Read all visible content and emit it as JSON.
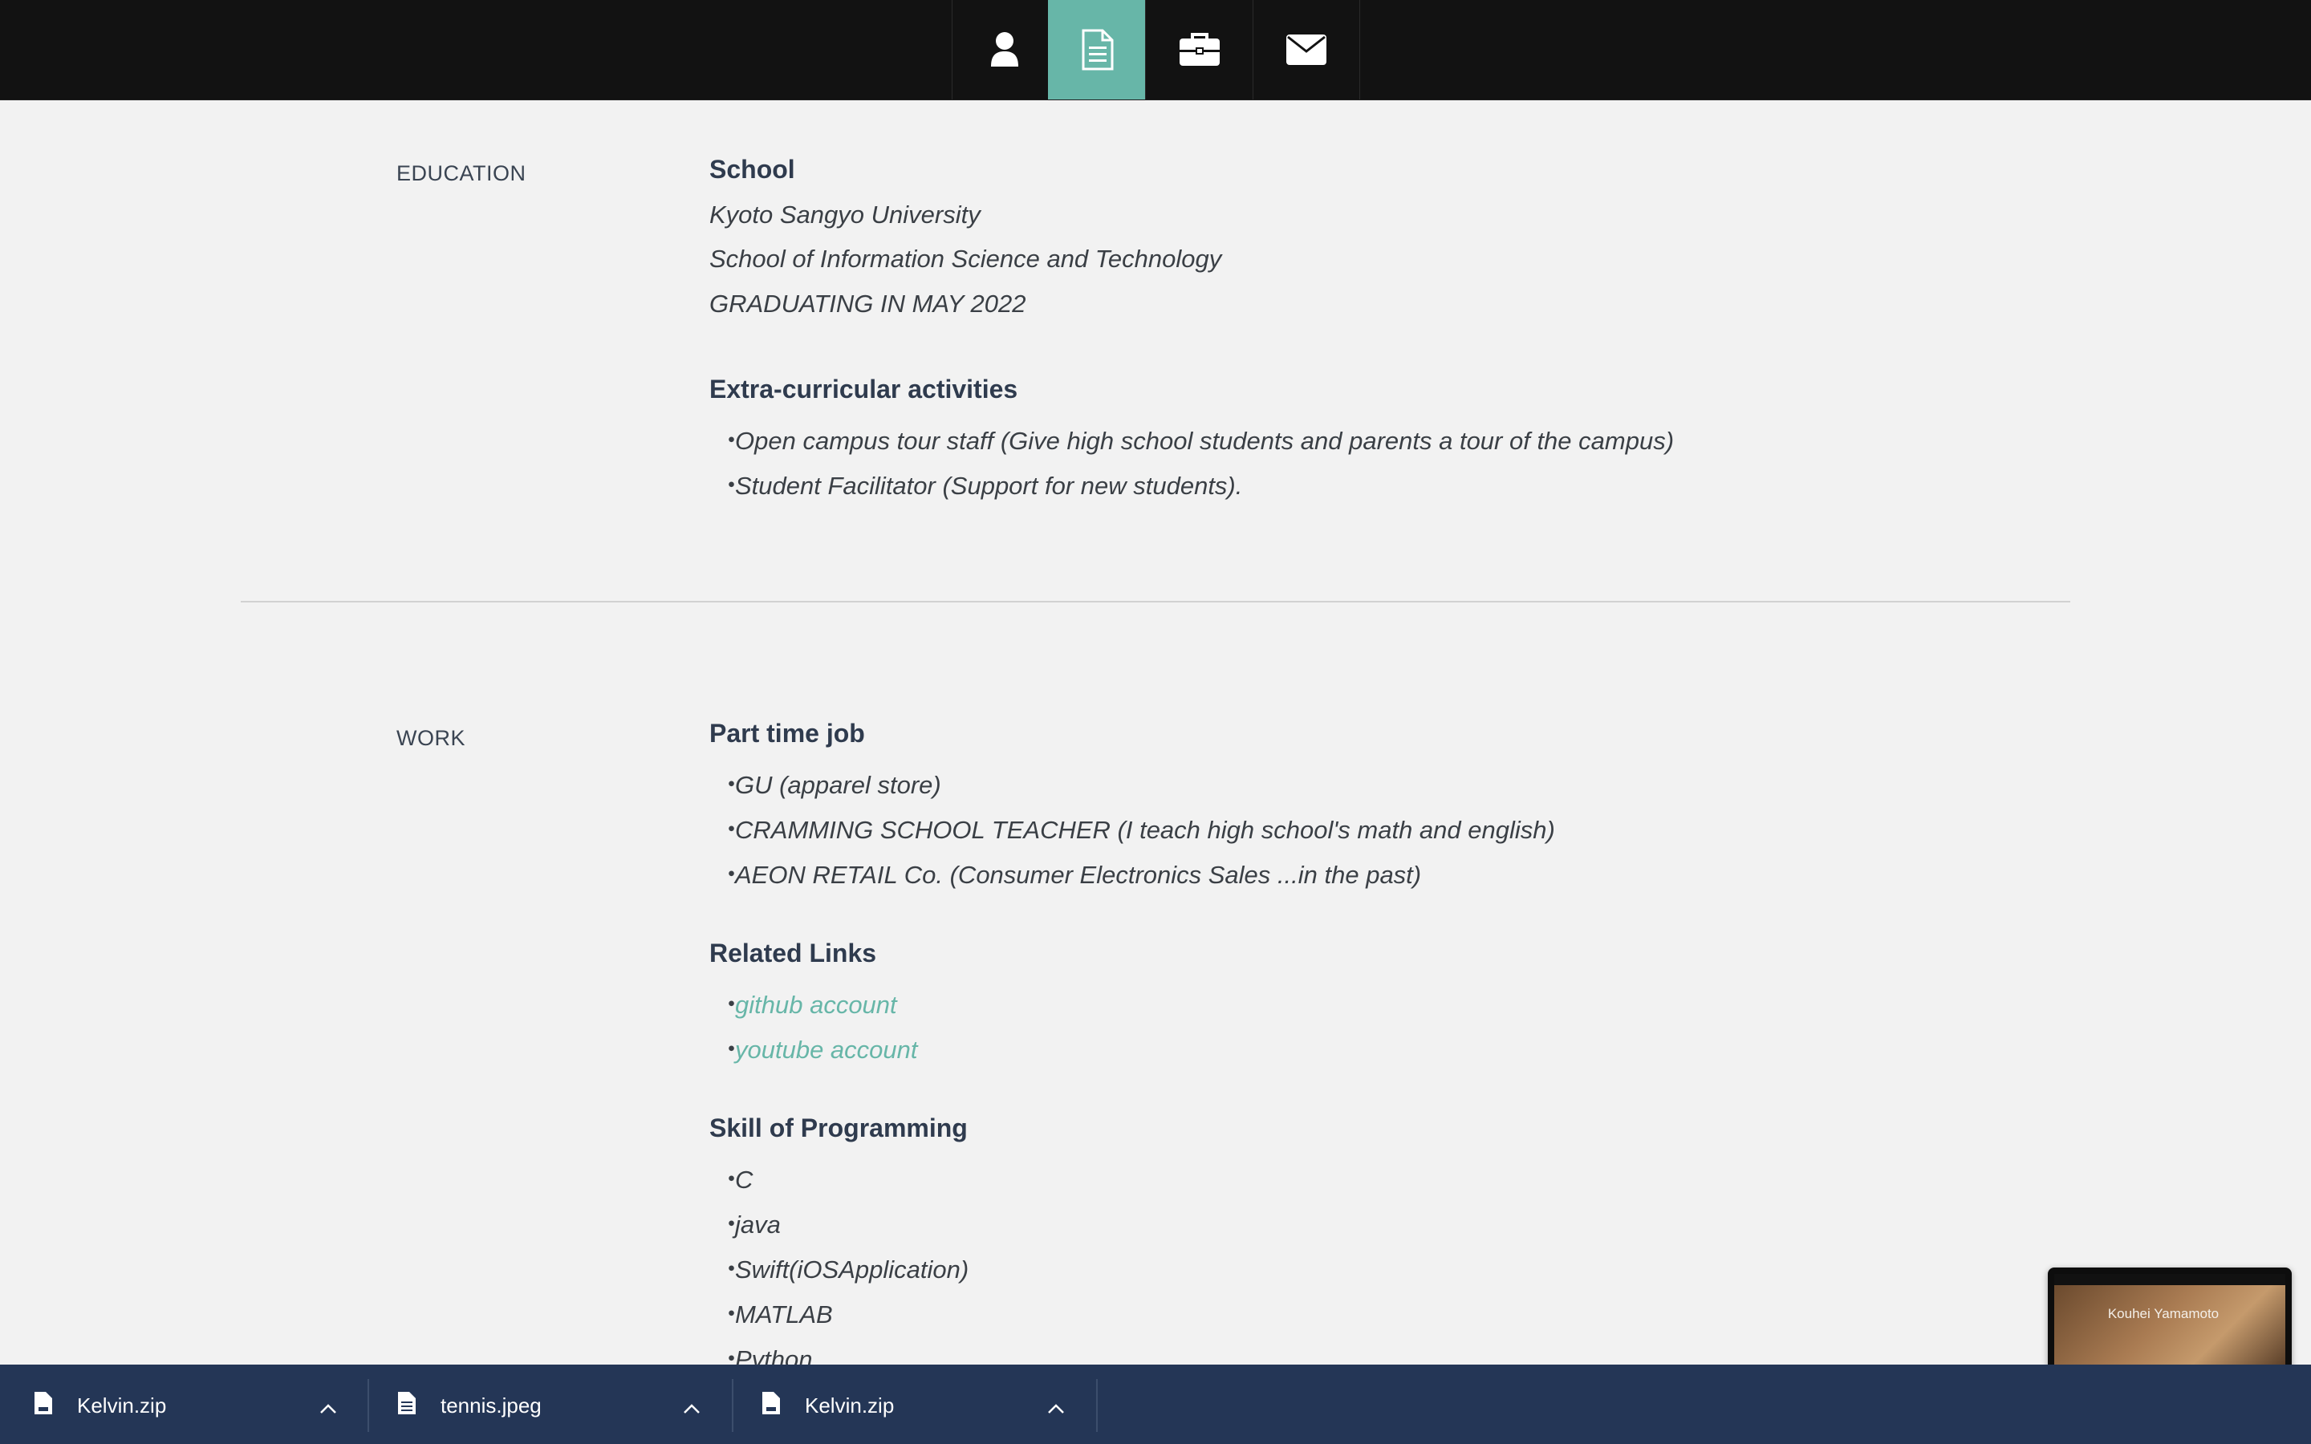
{
  "nav": {
    "items": [
      {
        "icon": "user-icon",
        "active": false
      },
      {
        "icon": "document-icon",
        "active": true
      },
      {
        "icon": "briefcase-icon",
        "active": false
      },
      {
        "icon": "envelope-icon",
        "active": false
      }
    ],
    "accent": "#67b6a8"
  },
  "education": {
    "label": "EDUCATION",
    "school_heading": "School",
    "school_lines": [
      "Kyoto Sangyo University",
      "School of Information Science and Technology",
      "GRADUATING IN MAY 2022"
    ],
    "activities_heading": "Extra-curricular activities",
    "activities": [
      "Open campus tour staff (Give high school students and parents a tour of the campus)",
      "Student Facilitator (Support for new students)."
    ]
  },
  "work": {
    "label": "WORK",
    "job_heading": "Part time job",
    "jobs": [
      "GU (apparel store)",
      "CRAMMING SCHOOL TEACHER (I teach high school's math and english)",
      "AEON RETAIL Co. (Consumer Electronics Sales ...in the past)"
    ],
    "links_heading": "Related Links",
    "links": [
      "github account",
      "youtube account"
    ],
    "skills_heading": "Skill of Programming",
    "skills": [
      "C",
      "java",
      "Swift(iOSApplication)",
      "MATLAB",
      "Python"
    ]
  },
  "bullet_char": "・",
  "downloads": [
    {
      "name": "Kelvin.zip"
    },
    {
      "name": "tennis.jpeg"
    },
    {
      "name": "Kelvin.zip"
    }
  ],
  "thumbnail": {
    "title": "Kouhei Yamamoto"
  },
  "colors": {
    "nav_bg": "#121212",
    "page_bg": "#f2f2f2",
    "download_bar": "#243656",
    "link": "#67b6a8"
  }
}
